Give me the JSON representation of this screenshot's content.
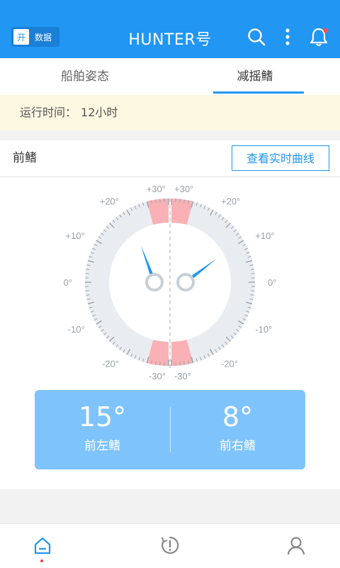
{
  "header": {
    "toggle_on_label": "开",
    "toggle_text": "数据",
    "title": "HUNTER号",
    "icons": [
      "search-icon",
      "more-vert-icon",
      "bell-icon"
    ],
    "notification_dot": true
  },
  "tabs": [
    {
      "label": "船舶姿态",
      "active": false
    },
    {
      "label": "减摇鳍",
      "active": true
    }
  ],
  "run_time": {
    "label": "运行时间：",
    "value": "12小时"
  },
  "section": {
    "title": "前鳍",
    "curve_button": "查看实时曲线"
  },
  "gauge": {
    "left_scale": [
      "+30°",
      "+20°",
      "+10°",
      "0°",
      "-10°",
      "-20°",
      "-30°"
    ],
    "right_scale": [
      "+30°",
      "+20°",
      "+10°",
      "0°",
      "-10°",
      "-20°",
      "-30°"
    ],
    "range_deg": [
      -30,
      30
    ],
    "warning_zone_from_deg": 25,
    "left_angle_deg": 15,
    "right_angle_deg": 8,
    "colors": {
      "dial": "#e9edf1",
      "tick": "#9aa3ab",
      "warning": "#f9b1b5",
      "needle": "#2196f3",
      "hub": "#c8d0d6",
      "label": "#9aa0a6"
    }
  },
  "readouts": [
    {
      "value": "15°",
      "label": "前左鳍"
    },
    {
      "value": "8°",
      "label": "前右鳍"
    }
  ],
  "bottom_nav": [
    {
      "name": "home",
      "icon": "home-icon",
      "active": true
    },
    {
      "name": "alarm",
      "icon": "alert-clock-icon",
      "active": false
    },
    {
      "name": "profile",
      "icon": "user-icon",
      "active": false
    }
  ],
  "theme": {
    "primary": "#2196f3",
    "run_bar_bg": "#fdf8e2",
    "readout_bg": "#7fc3fd"
  }
}
